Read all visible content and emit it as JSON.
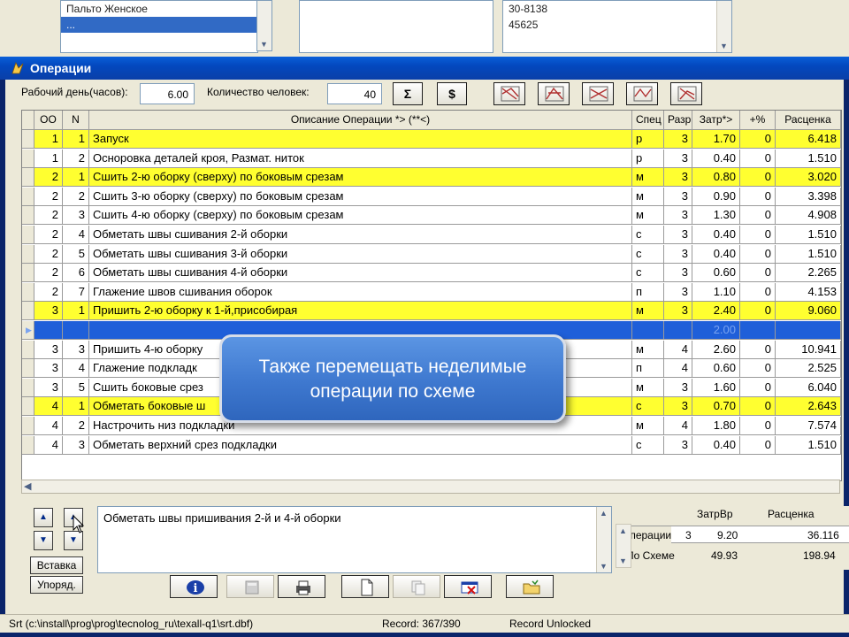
{
  "background": {
    "list_left": [
      "Пальто Женское",
      "..."
    ],
    "list_right": [
      "30-8138",
      "45625"
    ]
  },
  "window": {
    "title": "Операции"
  },
  "toolbar": {
    "workday_label": "Рабочий день(часов):",
    "workday_value": "6.00",
    "people_label": "Количество человек:",
    "people_value": "40",
    "sum_button": "Σ",
    "dollar_button": "$"
  },
  "grid": {
    "headers": [
      "OO",
      "N",
      "Описание Операции *>    (**<)",
      "Спец",
      "Разр",
      "Затр*>",
      "+%",
      "Расценка"
    ],
    "rows": [
      {
        "oo": "1",
        "n": "1",
        "desc": "Запуск",
        "spec": "р",
        "razr": "3",
        "zatr": "1.70",
        "pct": "0",
        "rate": "6.418",
        "hl": "yellow"
      },
      {
        "oo": "1",
        "n": "2",
        "desc": "Осноровка деталей кроя, Размат. ниток",
        "spec": "р",
        "razr": "3",
        "zatr": "0.40",
        "pct": "0",
        "rate": "1.510",
        "hl": "white"
      },
      {
        "oo": "2",
        "n": "1",
        "desc": "Сшить 2-ю оборку (сверху) по боковым срезам",
        "spec": "м",
        "razr": "3",
        "zatr": "0.80",
        "pct": "0",
        "rate": "3.020",
        "hl": "yellow"
      },
      {
        "oo": "2",
        "n": "2",
        "desc": "Сшить 3-ю оборку (сверху) по боковым срезам",
        "spec": "м",
        "razr": "3",
        "zatr": "0.90",
        "pct": "0",
        "rate": "3.398",
        "hl": "white"
      },
      {
        "oo": "2",
        "n": "3",
        "desc": "Сшить 4-ю оборку (сверху) по боковым срезам",
        "spec": "м",
        "razr": "3",
        "zatr": "1.30",
        "pct": "0",
        "rate": "4.908",
        "hl": "white"
      },
      {
        "oo": "2",
        "n": "4",
        "desc": "Обметать швы сшивания 2-й оборки",
        "spec": "с",
        "razr": "3",
        "zatr": "0.40",
        "pct": "0",
        "rate": "1.510",
        "hl": "white"
      },
      {
        "oo": "2",
        "n": "5",
        "desc": "Обметать швы сшивания 3-й оборки",
        "spec": "с",
        "razr": "3",
        "zatr": "0.40",
        "pct": "0",
        "rate": "1.510",
        "hl": "white"
      },
      {
        "oo": "2",
        "n": "6",
        "desc": "Обметать швы сшивания 4-й оборки",
        "spec": "с",
        "razr": "3",
        "zatr": "0.60",
        "pct": "0",
        "rate": "2.265",
        "hl": "white"
      },
      {
        "oo": "2",
        "n": "7",
        "desc": "Глажение швов сшивания оборок",
        "spec": "п",
        "razr": "3",
        "zatr": "1.10",
        "pct": "0",
        "rate": "4.153",
        "hl": "white"
      },
      {
        "oo": "3",
        "n": "1",
        "desc": "Пришить 2-ю оборку к 1-й,присобирая",
        "spec": "м",
        "razr": "3",
        "zatr": "2.40",
        "pct": "0",
        "rate": "9.060",
        "hl": "yellow"
      },
      {
        "oo": "",
        "n": "",
        "desc": "",
        "spec": "",
        "razr": "",
        "zatr": "2.00",
        "pct": "",
        "rate": "",
        "hl": "selected"
      },
      {
        "oo": "3",
        "n": "3",
        "desc": "Пришить 4-ю оборку",
        "spec": "м",
        "razr": "4",
        "zatr": "2.60",
        "pct": "0",
        "rate": "10.941",
        "hl": "white"
      },
      {
        "oo": "3",
        "n": "4",
        "desc": "Глажение подкладк",
        "spec": "п",
        "razr": "4",
        "zatr": "0.60",
        "pct": "0",
        "rate": "2.525",
        "hl": "white"
      },
      {
        "oo": "3",
        "n": "5",
        "desc": "Сшить боковые срез",
        "spec": "м",
        "razr": "3",
        "zatr": "1.60",
        "pct": "0",
        "rate": "6.040",
        "hl": "white"
      },
      {
        "oo": "4",
        "n": "1",
        "desc": "Обметать боковые ш",
        "spec": "с",
        "razr": "3",
        "zatr": "0.70",
        "pct": "0",
        "rate": "2.643",
        "hl": "yellow"
      },
      {
        "oo": "4",
        "n": "2",
        "desc": "Настрочить низ подкладки",
        "spec": "м",
        "razr": "4",
        "zatr": "1.80",
        "pct": "0",
        "rate": "7.574",
        "hl": "white"
      },
      {
        "oo": "4",
        "n": "3",
        "desc": "Обметать верхний срез подкладки",
        "spec": "с",
        "razr": "3",
        "zatr": "0.40",
        "pct": "0",
        "rate": "1.510",
        "hl": "white"
      }
    ]
  },
  "callout": {
    "line1": "Также перемещать неделимые",
    "line2": "операции по схеме"
  },
  "memo": {
    "text": "Обметать швы пришивания 2-й и 4-й оборки"
  },
  "side_buttons": {
    "insert": "Вставка",
    "order": "Упоряд."
  },
  "summary": {
    "col_zatr": "ЗатрВр",
    "col_rate": "Расценка",
    "row1_label": "Операции",
    "row1_count": "3",
    "row1_zatr": "9.20",
    "row1_rate": "36.116",
    "row2_label": "По Схеме",
    "row2_zatr": "49.93",
    "row2_rate": "198.94"
  },
  "statusbar": {
    "path": "Srt (c:\\install\\prog\\prog\\tecnolog_ru\\texall-q1\\srt.dbf)",
    "record": "Record: 367/390",
    "lock": "Record Unlocked"
  }
}
